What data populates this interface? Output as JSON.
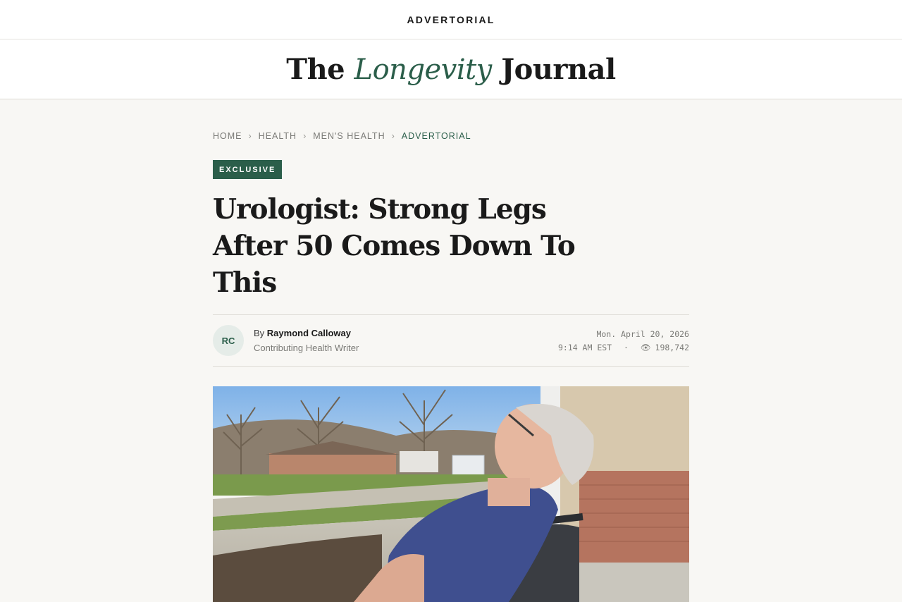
{
  "top_bar": {
    "label": "ADVERTORIAL"
  },
  "masthead": {
    "prefix": "The",
    "highlight": "Longevity",
    "suffix": "Journal"
  },
  "breadcrumb": [
    {
      "label": "HOME"
    },
    {
      "label": "HEALTH"
    },
    {
      "label": "MEN'S HEALTH"
    },
    {
      "label": "ADVERTORIAL"
    }
  ],
  "article": {
    "badge": "EXCLUSIVE",
    "headline": "Urologist: Strong Legs After 50 Comes Down To This",
    "author_initials": "RC",
    "by_prefix": "By",
    "author_name": "Raymond Calloway",
    "author_role": "Contributing Health Writer",
    "date": "Mon. April 20, 2026",
    "time": "9:14 AM EST",
    "views": "198,742",
    "views_icon": "eye-icon"
  },
  "colors": {
    "accent": "#2b5e4a",
    "background": "#f8f7f4",
    "text": "#1a1a1a"
  }
}
